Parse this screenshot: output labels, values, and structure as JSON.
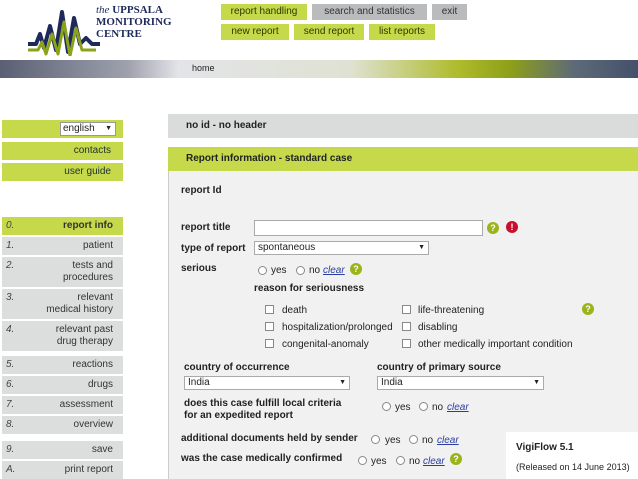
{
  "logo": {
    "line1": "the",
    "line1b": "UPPSALA",
    "line2": "MONITORING",
    "line3": "CENTRE"
  },
  "nav": {
    "top": [
      "report handling",
      "search and statistics",
      "exit"
    ],
    "sub": [
      "new report",
      "send report",
      "list reports"
    ]
  },
  "banner": {
    "home": "home"
  },
  "sidebar": {
    "language": "english",
    "links": [
      "contacts",
      "user guide"
    ],
    "steps": [
      {
        "num": "0.",
        "label": "report info"
      },
      {
        "num": "1.",
        "label": "patient"
      },
      {
        "num": "2.",
        "label": "tests and",
        "label2": "procedures"
      },
      {
        "num": "3.",
        "label": "relevant",
        "label2": "medical history"
      },
      {
        "num": "4.",
        "label": "relevant past",
        "label2": "drug therapy"
      },
      {
        "num": "5.",
        "label": "reactions"
      },
      {
        "num": "6.",
        "label": "drugs"
      },
      {
        "num": "7.",
        "label": "assessment"
      },
      {
        "num": "8.",
        "label": "overview"
      },
      {
        "num": "9.",
        "label": "save"
      },
      {
        "num": "A.",
        "label": "print report"
      }
    ]
  },
  "header": {
    "id_line": "no id - no header",
    "section": "Report information - standard case"
  },
  "form": {
    "report_id": "report Id",
    "report_title": "report title",
    "report_title_value": "",
    "type_label": "type of report",
    "type_value": "spontaneous",
    "serious_label": "serious",
    "yes": "yes",
    "no": "no",
    "clear": "clear",
    "reason_label": "reason for seriousness",
    "reasons_left": [
      "death",
      "hospitalization/prolonged",
      "congenital-anomaly"
    ],
    "reasons_right": [
      "life-threatening",
      "disabling",
      "other medically important condition"
    ],
    "country_occurrence_label": "country of occurrence",
    "country_occurrence_value": "India",
    "country_source_label": "country of primary source",
    "country_source_value": "India",
    "expedited_line1": "does this case fulfill local criteria",
    "expedited_line2": "for an expedited report",
    "additional_docs_label": "additional documents held by sender",
    "medically_confirmed_label": "was the case medically confirmed"
  },
  "version": {
    "name": "VigiFlow 5.1",
    "released": "(Released on 14 June 2013)"
  }
}
